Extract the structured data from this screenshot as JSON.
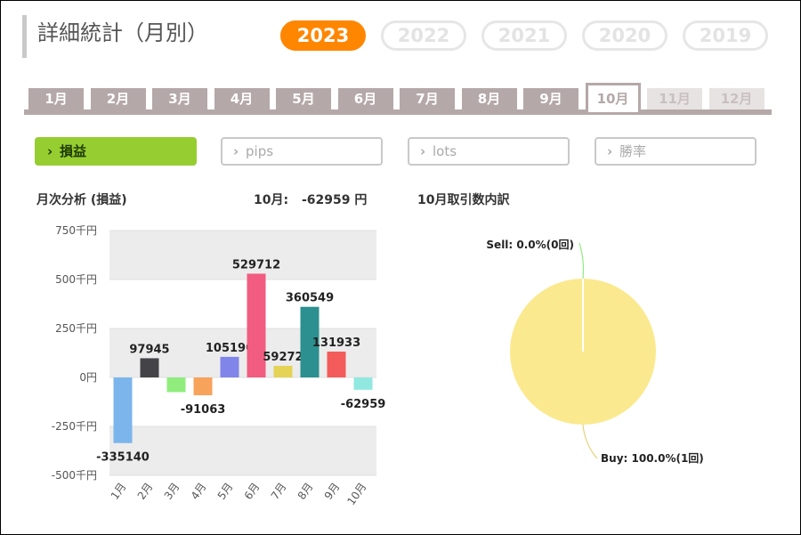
{
  "title": "詳細統計（月別）",
  "years": [
    {
      "label": "2023",
      "active": true
    },
    {
      "label": "2022",
      "active": false
    },
    {
      "label": "2021",
      "active": false
    },
    {
      "label": "2020",
      "active": false
    },
    {
      "label": "2019",
      "active": false
    }
  ],
  "months": [
    {
      "label": "1月",
      "state": "normal"
    },
    {
      "label": "2月",
      "state": "normal"
    },
    {
      "label": "3月",
      "state": "normal"
    },
    {
      "label": "4月",
      "state": "normal"
    },
    {
      "label": "5月",
      "state": "normal"
    },
    {
      "label": "6月",
      "state": "normal"
    },
    {
      "label": "7月",
      "state": "normal"
    },
    {
      "label": "8月",
      "state": "normal"
    },
    {
      "label": "9月",
      "state": "normal"
    },
    {
      "label": "10月",
      "state": "active"
    },
    {
      "label": "11月",
      "state": "future"
    },
    {
      "label": "12月",
      "state": "future"
    }
  ],
  "metrics": [
    {
      "label": "損益",
      "active": true
    },
    {
      "label": "pips",
      "active": false
    },
    {
      "label": "lots",
      "active": false
    },
    {
      "label": "勝率",
      "active": false
    }
  ],
  "icons": {
    "metric_chevron": "chevron-right-icon"
  },
  "bar_panel": {
    "title": "月次分析 (損益)",
    "month_label": "10月:",
    "month_value": "-62959 円"
  },
  "pie_panel": {
    "title": "10月取引数内訳"
  },
  "chart_data": [
    {
      "type": "bar",
      "title": "月次分析 (損益)",
      "categories": [
        "1月",
        "2月",
        "3月",
        "4月",
        "5月",
        "6月",
        "7月",
        "8月",
        "9月",
        "10月"
      ],
      "values": [
        -335140,
        97945,
        -75000,
        -91063,
        105190,
        529712,
        59272,
        360549,
        131933,
        -62959
      ],
      "value_labels": [
        "-335140",
        "97945",
        "",
        "-91063",
        "105190",
        "529712",
        "59272",
        "360549",
        "131933",
        "-62959"
      ],
      "colors": [
        "#7cb5ec",
        "#434348",
        "#90ed7d",
        "#f7a35c",
        "#8085e9",
        "#f15c80",
        "#e4d354",
        "#2b908f",
        "#f45b5b",
        "#91e8e1"
      ],
      "ylim": [
        -500000,
        750000
      ],
      "yticks": [
        750000,
        500000,
        250000,
        0,
        -250000,
        -500000
      ],
      "ytick_labels": [
        "750千円",
        "500千円",
        "250千円",
        "0円",
        "-250千円",
        "-500千円"
      ],
      "grid": true
    },
    {
      "type": "pie",
      "title": "10月取引数内訳",
      "slices": [
        {
          "label": "Sell: 0.0%(0回)",
          "value": 0,
          "color": "#90ed7d"
        },
        {
          "label": "Buy: 100.0%(1回)",
          "value": 1,
          "color": "#fbe98f"
        }
      ]
    }
  ]
}
